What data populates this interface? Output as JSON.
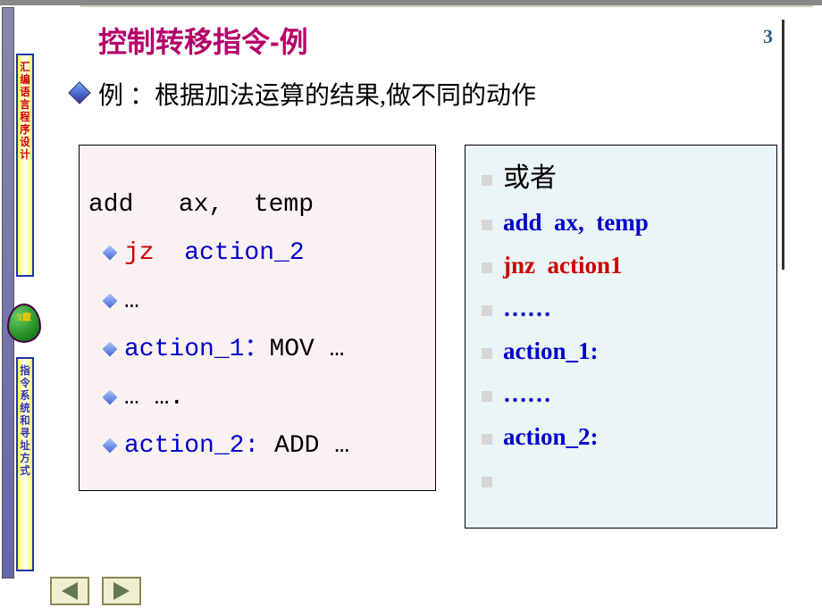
{
  "slide": {
    "title": "控制转移指令-例",
    "number": "3"
  },
  "sidebar": {
    "top_text": "汇编语言程序设计",
    "chapter": "3章",
    "bottom_text": "指令系统和寻址方式"
  },
  "example_heading": "例 ：根据加法运算的结果,做不同的动作",
  "left_code": {
    "line1": "add   ax,  temp",
    "line2_a": "jz",
    "line2_b": "  action_2",
    "line3": "…",
    "line4_a": "action_1：",
    "line4_b": "MOV …",
    "line5": "… ….",
    "line6_a": "action_2:",
    "line6_b": " ADD …"
  },
  "right_code": {
    "heading": "或者",
    "line1": "add  ax,  temp",
    "line2": "jnz  action1",
    "line3": "……",
    "line4": "action_1:",
    "line5": "……",
    "line6": "action_2:"
  },
  "nav": {
    "prev": "prev",
    "next": "next"
  }
}
